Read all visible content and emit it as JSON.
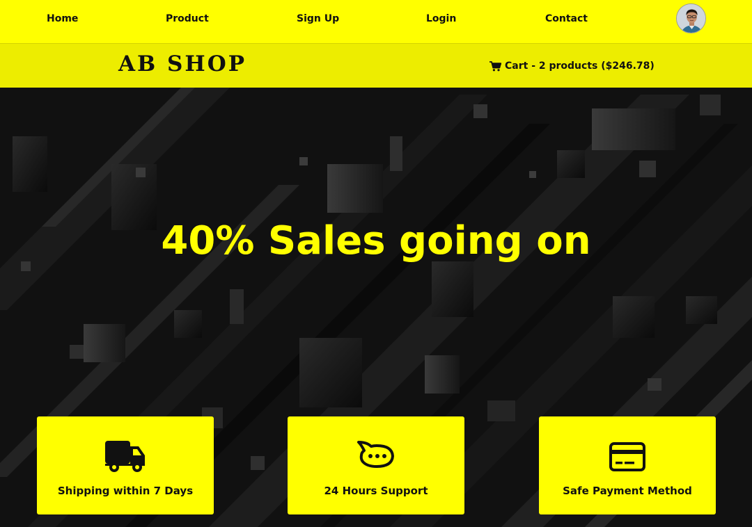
{
  "nav": {
    "items": [
      {
        "label": "Home"
      },
      {
        "label": "Product"
      },
      {
        "label": "Sign Up"
      },
      {
        "label": "Login"
      },
      {
        "label": "Contact"
      }
    ]
  },
  "header": {
    "logo": "AB SHOP",
    "cart_text": "Cart - 2 products ($246.78)"
  },
  "hero": {
    "title": "40% Sales going on"
  },
  "features": [
    {
      "label": "Shipping within 7 Days",
      "icon": "truck-icon"
    },
    {
      "label": "24 Hours Support",
      "icon": "chat-bubble-icon"
    },
    {
      "label": "Safe Payment Method",
      "icon": "credit-card-icon"
    }
  ],
  "colors": {
    "accent": "#ffff00",
    "header_band": "#eded00",
    "hero_background": "#101010",
    "text_dark": "#111111"
  }
}
